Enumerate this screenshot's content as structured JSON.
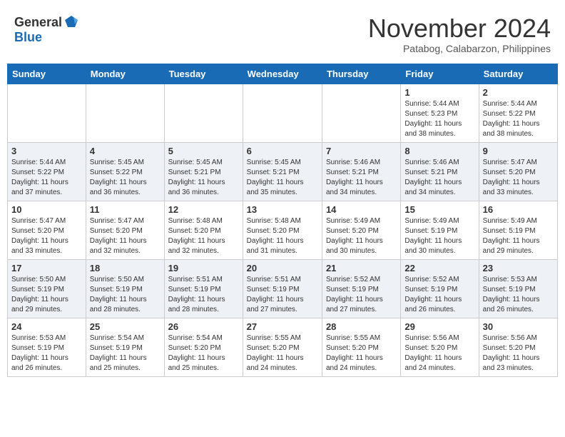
{
  "header": {
    "logo_general": "General",
    "logo_blue": "Blue",
    "month_title": "November 2024",
    "location": "Patabog, Calabarzon, Philippines"
  },
  "columns": [
    "Sunday",
    "Monday",
    "Tuesday",
    "Wednesday",
    "Thursday",
    "Friday",
    "Saturday"
  ],
  "weeks": [
    {
      "days": [
        {
          "num": "",
          "info": ""
        },
        {
          "num": "",
          "info": ""
        },
        {
          "num": "",
          "info": ""
        },
        {
          "num": "",
          "info": ""
        },
        {
          "num": "",
          "info": ""
        },
        {
          "num": "1",
          "info": "Sunrise: 5:44 AM\nSunset: 5:23 PM\nDaylight: 11 hours\nand 38 minutes."
        },
        {
          "num": "2",
          "info": "Sunrise: 5:44 AM\nSunset: 5:22 PM\nDaylight: 11 hours\nand 38 minutes."
        }
      ]
    },
    {
      "days": [
        {
          "num": "3",
          "info": "Sunrise: 5:44 AM\nSunset: 5:22 PM\nDaylight: 11 hours\nand 37 minutes."
        },
        {
          "num": "4",
          "info": "Sunrise: 5:45 AM\nSunset: 5:22 PM\nDaylight: 11 hours\nand 36 minutes."
        },
        {
          "num": "5",
          "info": "Sunrise: 5:45 AM\nSunset: 5:21 PM\nDaylight: 11 hours\nand 36 minutes."
        },
        {
          "num": "6",
          "info": "Sunrise: 5:45 AM\nSunset: 5:21 PM\nDaylight: 11 hours\nand 35 minutes."
        },
        {
          "num": "7",
          "info": "Sunrise: 5:46 AM\nSunset: 5:21 PM\nDaylight: 11 hours\nand 34 minutes."
        },
        {
          "num": "8",
          "info": "Sunrise: 5:46 AM\nSunset: 5:21 PM\nDaylight: 11 hours\nand 34 minutes."
        },
        {
          "num": "9",
          "info": "Sunrise: 5:47 AM\nSunset: 5:20 PM\nDaylight: 11 hours\nand 33 minutes."
        }
      ]
    },
    {
      "days": [
        {
          "num": "10",
          "info": "Sunrise: 5:47 AM\nSunset: 5:20 PM\nDaylight: 11 hours\nand 33 minutes."
        },
        {
          "num": "11",
          "info": "Sunrise: 5:47 AM\nSunset: 5:20 PM\nDaylight: 11 hours\nand 32 minutes."
        },
        {
          "num": "12",
          "info": "Sunrise: 5:48 AM\nSunset: 5:20 PM\nDaylight: 11 hours\nand 32 minutes."
        },
        {
          "num": "13",
          "info": "Sunrise: 5:48 AM\nSunset: 5:20 PM\nDaylight: 11 hours\nand 31 minutes."
        },
        {
          "num": "14",
          "info": "Sunrise: 5:49 AM\nSunset: 5:20 PM\nDaylight: 11 hours\nand 30 minutes."
        },
        {
          "num": "15",
          "info": "Sunrise: 5:49 AM\nSunset: 5:19 PM\nDaylight: 11 hours\nand 30 minutes."
        },
        {
          "num": "16",
          "info": "Sunrise: 5:49 AM\nSunset: 5:19 PM\nDaylight: 11 hours\nand 29 minutes."
        }
      ]
    },
    {
      "days": [
        {
          "num": "17",
          "info": "Sunrise: 5:50 AM\nSunset: 5:19 PM\nDaylight: 11 hours\nand 29 minutes."
        },
        {
          "num": "18",
          "info": "Sunrise: 5:50 AM\nSunset: 5:19 PM\nDaylight: 11 hours\nand 28 minutes."
        },
        {
          "num": "19",
          "info": "Sunrise: 5:51 AM\nSunset: 5:19 PM\nDaylight: 11 hours\nand 28 minutes."
        },
        {
          "num": "20",
          "info": "Sunrise: 5:51 AM\nSunset: 5:19 PM\nDaylight: 11 hours\nand 27 minutes."
        },
        {
          "num": "21",
          "info": "Sunrise: 5:52 AM\nSunset: 5:19 PM\nDaylight: 11 hours\nand 27 minutes."
        },
        {
          "num": "22",
          "info": "Sunrise: 5:52 AM\nSunset: 5:19 PM\nDaylight: 11 hours\nand 26 minutes."
        },
        {
          "num": "23",
          "info": "Sunrise: 5:53 AM\nSunset: 5:19 PM\nDaylight: 11 hours\nand 26 minutes."
        }
      ]
    },
    {
      "days": [
        {
          "num": "24",
          "info": "Sunrise: 5:53 AM\nSunset: 5:19 PM\nDaylight: 11 hours\nand 26 minutes."
        },
        {
          "num": "25",
          "info": "Sunrise: 5:54 AM\nSunset: 5:19 PM\nDaylight: 11 hours\nand 25 minutes."
        },
        {
          "num": "26",
          "info": "Sunrise: 5:54 AM\nSunset: 5:20 PM\nDaylight: 11 hours\nand 25 minutes."
        },
        {
          "num": "27",
          "info": "Sunrise: 5:55 AM\nSunset: 5:20 PM\nDaylight: 11 hours\nand 24 minutes."
        },
        {
          "num": "28",
          "info": "Sunrise: 5:55 AM\nSunset: 5:20 PM\nDaylight: 11 hours\nand 24 minutes."
        },
        {
          "num": "29",
          "info": "Sunrise: 5:56 AM\nSunset: 5:20 PM\nDaylight: 11 hours\nand 24 minutes."
        },
        {
          "num": "30",
          "info": "Sunrise: 5:56 AM\nSunset: 5:20 PM\nDaylight: 11 hours\nand 23 minutes."
        }
      ]
    }
  ]
}
